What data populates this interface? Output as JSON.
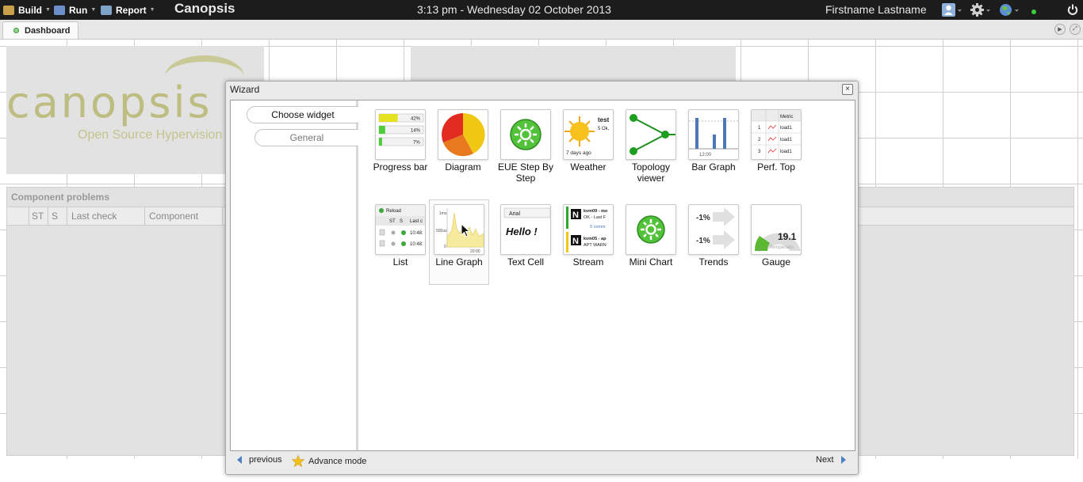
{
  "topbar": {
    "menus": [
      {
        "label": "Build",
        "icon": "build-icon"
      },
      {
        "label": "Run",
        "icon": "run-icon"
      },
      {
        "label": "Report",
        "icon": "report-icon"
      }
    ],
    "app_title": "Canopsis",
    "datetime": "3:13 pm - Wednesday 02 October 2013",
    "user_name": "Firstname Lastname",
    "icons": [
      "user-icon",
      "gear-icon",
      "globe-icon",
      "status-dot-icon",
      "power-icon"
    ]
  },
  "tabs": [
    {
      "label": "Dashboard"
    }
  ],
  "dashboard": {
    "logo_text": "canopsis",
    "logo_subtitle": "Open Source Hypervision",
    "component_panel": {
      "title": "Component problems",
      "columns": [
        "ST",
        "S",
        "Last check",
        "Component"
      ]
    }
  },
  "wizard": {
    "title": "Wizard",
    "steps": [
      "Choose widget",
      "General"
    ],
    "widgets": [
      {
        "label": "Progress bar",
        "progress": [
          0.42,
          0.14,
          0.07
        ],
        "progress_labels": [
          "42%",
          "14%",
          "7%"
        ]
      },
      {
        "label": "Diagram"
      },
      {
        "label": "EUE Step By Step"
      },
      {
        "label": "Weather",
        "thumb_text": [
          "test",
          "5 Ok,",
          "7 days ago"
        ]
      },
      {
        "label": "Topology viewer"
      },
      {
        "label": "Bar Graph",
        "thumb_text": [
          "12:00"
        ]
      },
      {
        "label": "Perf. Top",
        "thumb_text": [
          "Metric",
          "load1"
        ]
      },
      {
        "label": "List",
        "thumb_text": [
          "Reload",
          "ST",
          "S",
          "Last c",
          "10:48:"
        ]
      },
      {
        "label": "Line Graph",
        "thumb_text": [
          "1ms",
          "500us",
          "0",
          "20:00"
        ]
      },
      {
        "label": "Text Cell",
        "thumb_text": [
          "Arial",
          "Hello !"
        ]
      },
      {
        "label": "Stream",
        "thumb_text": [
          "kvm09 - mo",
          "OK - Last F",
          "0 comm",
          "kvm05 - ap",
          "APT WARN"
        ]
      },
      {
        "label": "Mini Chart"
      },
      {
        "label": "Trends",
        "thumb_text": [
          "-1%",
          "-1%"
        ]
      },
      {
        "label": "Gauge",
        "thumb_text": [
          "19.1",
          "0",
          "Temperatu"
        ],
        "value": 19.1
      }
    ],
    "footer": {
      "previous": "previous",
      "advance": "Advance mode",
      "next": "Next"
    }
  }
}
